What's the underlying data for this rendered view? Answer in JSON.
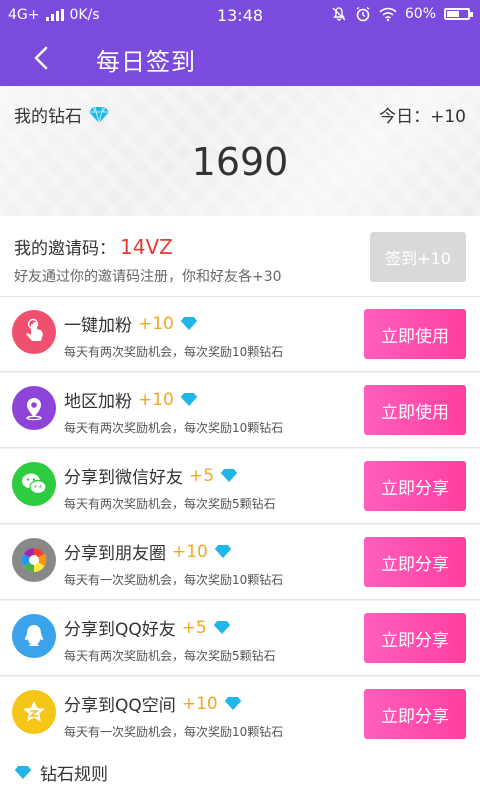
{
  "statusbar": {
    "network": "4G+",
    "speed": "0K/s",
    "time": "13:48",
    "battery": "60%",
    "battery_level": 0.6
  },
  "header": {
    "title": "每日签到"
  },
  "diamonds": {
    "label": "我的钻石",
    "today": "今日：+10",
    "count": "1690"
  },
  "invite": {
    "label": "我的邀请码：",
    "code": "14VZ",
    "hint": "好友通过你的邀请码注册，你和好友各+30",
    "sign_button": "签到+10"
  },
  "tasks": [
    {
      "name": "一键加粉",
      "bonus": "+10",
      "desc": "每天有两次奖励机会，每次奖励10颗钻石",
      "button": "立即使用",
      "icon": "touch-icon",
      "color": "#f0506e"
    },
    {
      "name": "地区加粉",
      "bonus": "+10",
      "desc": "每天有两次奖励机会，每次奖励10颗钻石",
      "button": "立即使用",
      "icon": "location-icon",
      "color": "#8e44d8"
    },
    {
      "name": "分享到微信好友",
      "bonus": "+5",
      "desc": "每天有两次奖励机会，每次奖励5颗钻石",
      "button": "立即分享",
      "icon": "wechat-icon",
      "color": "#2ecc40"
    },
    {
      "name": "分享到朋友圈",
      "bonus": "+10",
      "desc": "每天有一次奖励机会，每次奖励10颗钻石",
      "button": "立即分享",
      "icon": "moments-icon",
      "color": "#888888"
    },
    {
      "name": "分享到QQ好友",
      "bonus": "+5",
      "desc": "每天有两次奖励机会，每次奖励5颗钻石",
      "button": "立即分享",
      "icon": "qq-icon",
      "color": "#3aa3ea"
    },
    {
      "name": "分享到QQ空间",
      "bonus": "+10",
      "desc": "每天有一次奖励机会，每次奖励10颗钻石",
      "button": "立即分享",
      "icon": "qzone-icon",
      "color": "#f5c518"
    }
  ],
  "rules": {
    "label": "钻石规则"
  },
  "colors": {
    "primary": "#7a4bdc",
    "accent": "#ff4fae",
    "bonus": "#f5a623",
    "code": "#e53935",
    "diamond": "#1fb6e8"
  }
}
